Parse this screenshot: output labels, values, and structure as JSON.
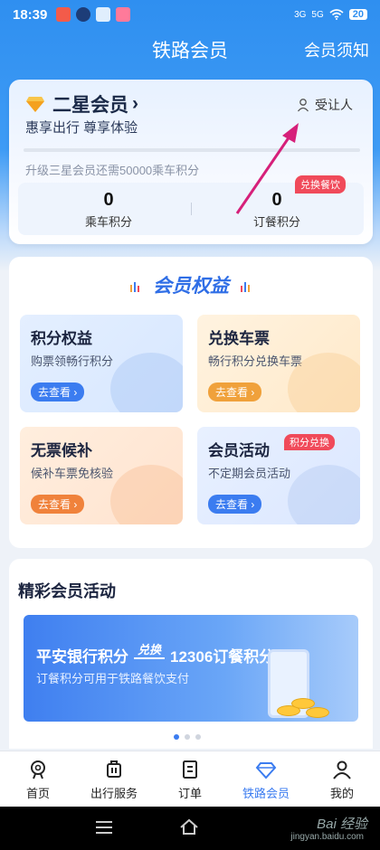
{
  "status_bar": {
    "time": "18:39",
    "battery": "20",
    "signal_a": "3G",
    "signal_b": "5G"
  },
  "nav": {
    "title": "铁路会员",
    "notice": "会员须知"
  },
  "member": {
    "level": "二星会员",
    "slogan": "惠享出行 尊享体验",
    "transfer": "受让人",
    "upgrade_hint": "升级三星会员还需50000乘车积分",
    "progress": 0,
    "ride_points": {
      "value": "0",
      "label": "乘车积分"
    },
    "meal_points": {
      "value": "0",
      "label": "订餐积分",
      "tag": "兑换餐饮"
    }
  },
  "benefits": {
    "title": "会员权益",
    "tiles": [
      {
        "title": "积分权益",
        "desc": "购票领畅行积分",
        "go": "去查看"
      },
      {
        "title": "兑换车票",
        "desc": "畅行积分兑换车票",
        "go": "去查看"
      },
      {
        "title": "无票候补",
        "desc": "候补车票免核验",
        "go": "去查看"
      },
      {
        "title": "会员活动",
        "desc": "不定期会员活动",
        "go": "去查看",
        "badge": "积分兑换"
      }
    ]
  },
  "activities": {
    "heading": "精彩会员活动",
    "banner": {
      "left": "平安银行积分",
      "exchange": "兑换",
      "right": "12306订餐积分",
      "sub": "订餐积分可用于铁路餐饮支付"
    }
  },
  "tabs": [
    {
      "label": "首页",
      "icon": "home-icon"
    },
    {
      "label": "出行服务",
      "icon": "luggage-icon"
    },
    {
      "label": "订单",
      "icon": "order-icon"
    },
    {
      "label": "铁路会员",
      "icon": "diamond-icon"
    },
    {
      "label": "我的",
      "icon": "profile-icon"
    }
  ],
  "watermark": {
    "text": "Bai 经验",
    "sub": "jingyan.baidu.com"
  },
  "colors": {
    "primary": "#3b7cf0",
    "header": "#2f8ff0",
    "badge": "#f04a5a"
  }
}
